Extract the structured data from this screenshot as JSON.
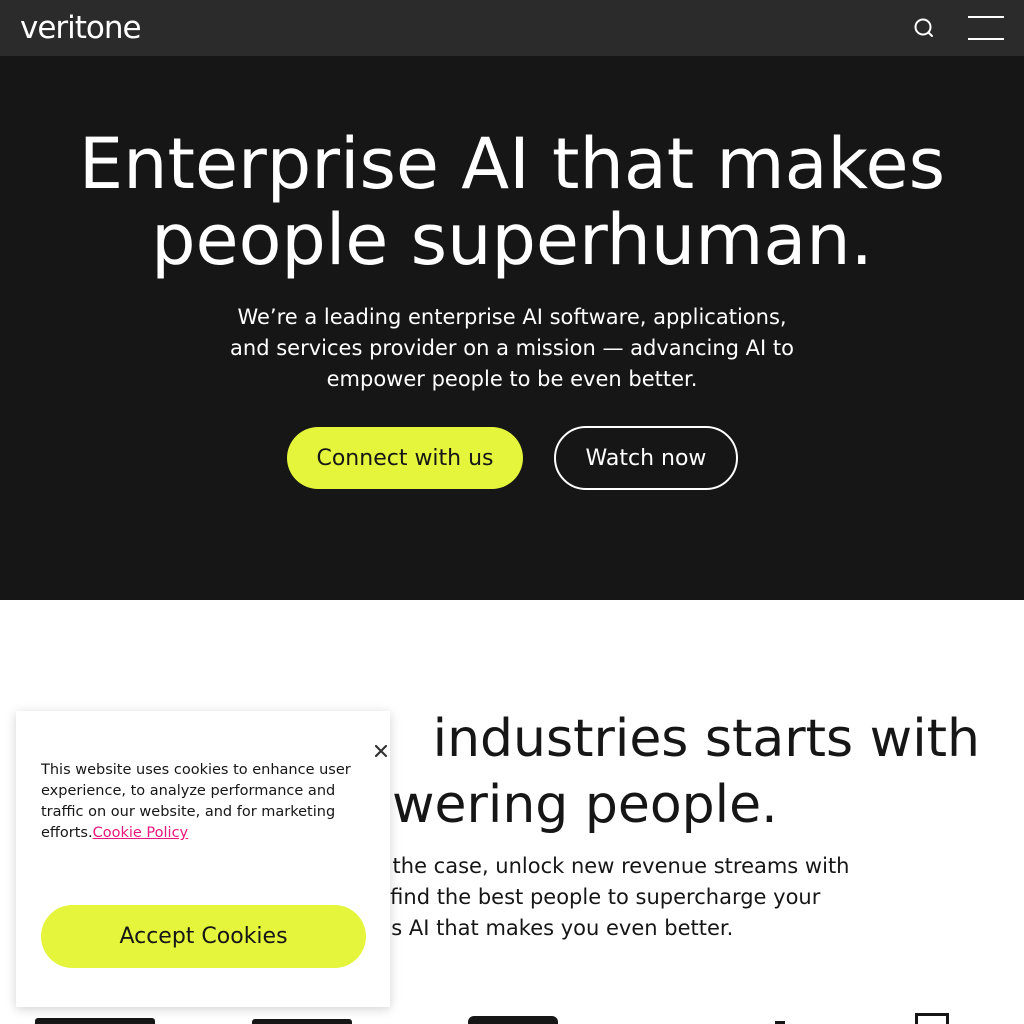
{
  "nav": {
    "logo_text": "veritone",
    "search_icon": "search-icon",
    "menu_icon": "hamburger-menu-icon",
    "background": "#2b2b2b"
  },
  "hero": {
    "title_line1": "Enterprise AI that makes",
    "title_line2": "people superhuman.",
    "subtitle_line1": "We’re a leading enterprise AI software, applications,",
    "subtitle_line2": "and services provider on a mission — advancing AI to",
    "subtitle_line3": "empower people to be even better.",
    "primary_button": "Connect with us",
    "secondary_button": "Watch now",
    "background": "#161616",
    "accent": "#e4f53c"
  },
  "section2": {
    "heading_line1": "industries starts with",
    "heading_line2": "wering people.",
    "body_line1": "es the case, unlock new revenue streams with",
    "body_line2": "or find the best people to supercharge your",
    "body_line3": "is is AI that makes you even better."
  },
  "cookie_banner": {
    "text": "This website uses cookies to enhance user experience, to analyze performance and traffic on our website, and for marketing efforts.",
    "policy_link": "Cookie Policy",
    "accept_button": "Accept Cookies",
    "close_icon": "close-icon",
    "link_color": "#e7177e"
  }
}
